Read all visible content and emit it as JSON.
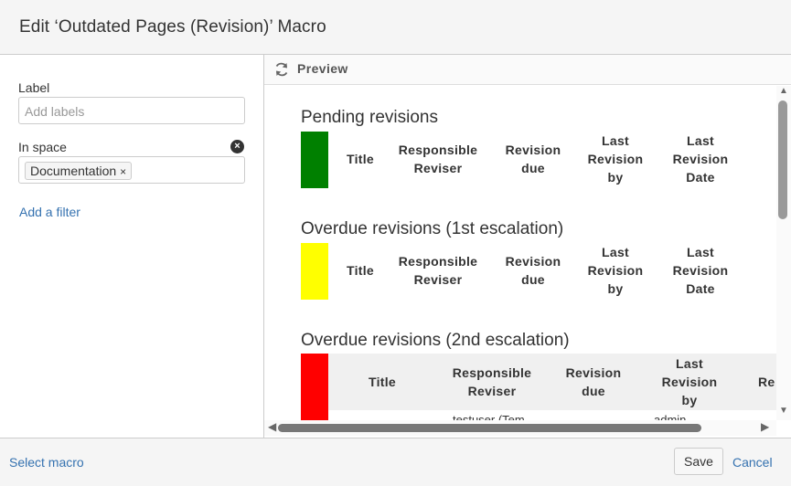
{
  "dialog": {
    "title": "Edit ‘Outdated Pages (Revision)’ Macro"
  },
  "form": {
    "label_field": {
      "label": "Label",
      "placeholder": "Add labels"
    },
    "space_field": {
      "label": "In space",
      "tag": "Documentation",
      "tag_remove": "×",
      "clear_icon": "×"
    },
    "add_filter": "Add a filter"
  },
  "preview": {
    "label": "Preview",
    "sections": [
      {
        "title": "Pending revisions",
        "color": "#008000"
      },
      {
        "title": "Overdue revisions (1st escalation)",
        "color": "#ffff00"
      },
      {
        "title": "Overdue revisions (2nd escalation)",
        "color": "#ff0000"
      }
    ],
    "columns": {
      "title": "Title",
      "responsible_l1": "Responsible",
      "responsible_l2": "Reviser",
      "due_l1": "Revision",
      "due_l2": "due",
      "lastby_l1": "Last",
      "lastby_l2": "Revision",
      "lastby_l3": "by",
      "lastdate_l1": "Last",
      "lastdate_l2": "Revision",
      "lastdate_l3": "Date",
      "cut_re": "Re"
    },
    "cut_row": {
      "reviser": "testuser (Tem",
      "by": "admin"
    }
  },
  "footer": {
    "select_macro": "Select macro",
    "save": "Save",
    "cancel": "Cancel"
  }
}
